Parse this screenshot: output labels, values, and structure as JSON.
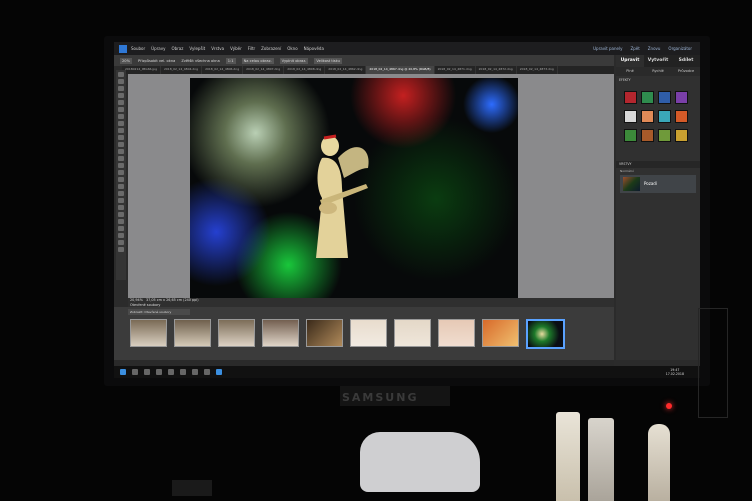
{
  "menu": {
    "items": [
      "Soubor",
      "Úpravy",
      "Obraz",
      "Vylepšit",
      "Vrstva",
      "Výběr",
      "Filtr",
      "Zobrazení",
      "Okno",
      "Nápověda"
    ],
    "right": [
      "Upravit panely",
      "Zpět",
      "Znovu",
      "Organizátor"
    ]
  },
  "options": {
    "zoom": "20%",
    "buttons": [
      "Přizpůsobit vel. okna",
      "Zvětšit všechna okna",
      "1:1",
      "Na celou obraz.",
      "Vyplnit obraz.",
      "Velikost tisku"
    ]
  },
  "tabs": [
    "20180214_IMG66.jpg",
    "2018_02_14_4804.dng",
    "2018_02_14_4806.dng",
    "2018_02_14_4807.dng",
    "2018_02_14_4808.dng",
    "2018_02_14_4862.dng",
    "2018_02_14_4867.dng @ 20,8% (RGB/8)",
    "2018_02_14_4871.dng",
    "2018_02_14_4872.dng",
    "2018_02_14_4873.dng"
  ],
  "active_tab": 6,
  "status": {
    "zoom": "20,94%",
    "size": "37,05 cm x 26,65 cm (240 ppi)",
    "line2": "Otevřené soubory"
  },
  "bin": {
    "label": "Zobrazit: Otevřené soubory"
  },
  "panel": {
    "tabs": [
      "Upravit",
      "Vytvořit",
      "Sdílet"
    ],
    "subtabs": [
      "Plné",
      "Rychlé",
      "Průvodce"
    ],
    "effects_label": "EFEKTY",
    "layers_label": "VRSTVY",
    "layer_name": "Pozadí",
    "layers_mode": "Normální"
  },
  "taskbar": {
    "time": "19:47",
    "date": "17.02.2018"
  },
  "monitor_brand": "SAMSUNG",
  "colors": {
    "accent": "#2f78d6",
    "swatches": [
      "#b4262e",
      "#2f8c4e",
      "#2f5da8",
      "#7a3fa8",
      "#d8d8d8",
      "#e08a57",
      "#3aa7b8",
      "#d45a28",
      "#3c8a3a",
      "#a85a2a",
      "#6f9a3a",
      "#c9a030"
    ]
  }
}
